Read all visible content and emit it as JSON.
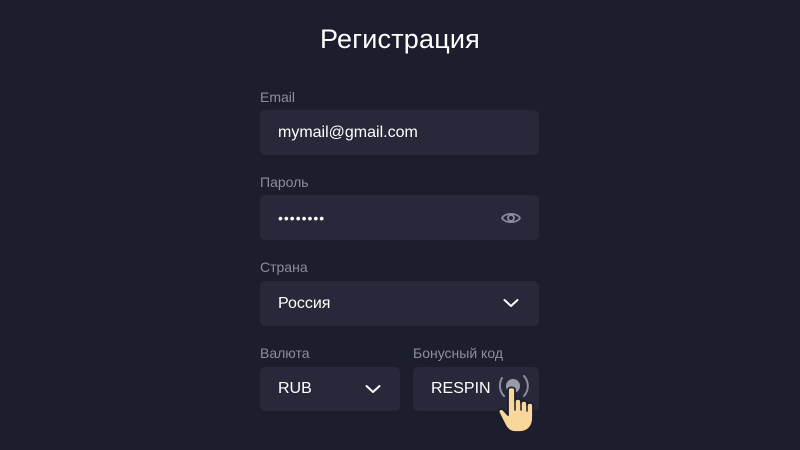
{
  "page": {
    "title": "Регистрация"
  },
  "form": {
    "email": {
      "label": "Email",
      "value": "mymail@gmail.com"
    },
    "password": {
      "label": "Пароль",
      "value": "••••••••",
      "toggle_icon": "eye-icon"
    },
    "country": {
      "label": "Страна",
      "value": "Россия",
      "dropdown_icon": "chevron-down-icon"
    },
    "currency": {
      "label": "Валюта",
      "value": "RUB",
      "dropdown_icon": "chevron-down-icon"
    },
    "bonus_code": {
      "label": "Бонусный код",
      "value": "RESPIN",
      "pointer_icon": "hand-pointer-icon"
    }
  },
  "colors": {
    "background": "#1c1d2d",
    "field_background": "#272839",
    "label": "#8b8d9e",
    "text": "#ffffff",
    "hand": "#f7d79a"
  }
}
